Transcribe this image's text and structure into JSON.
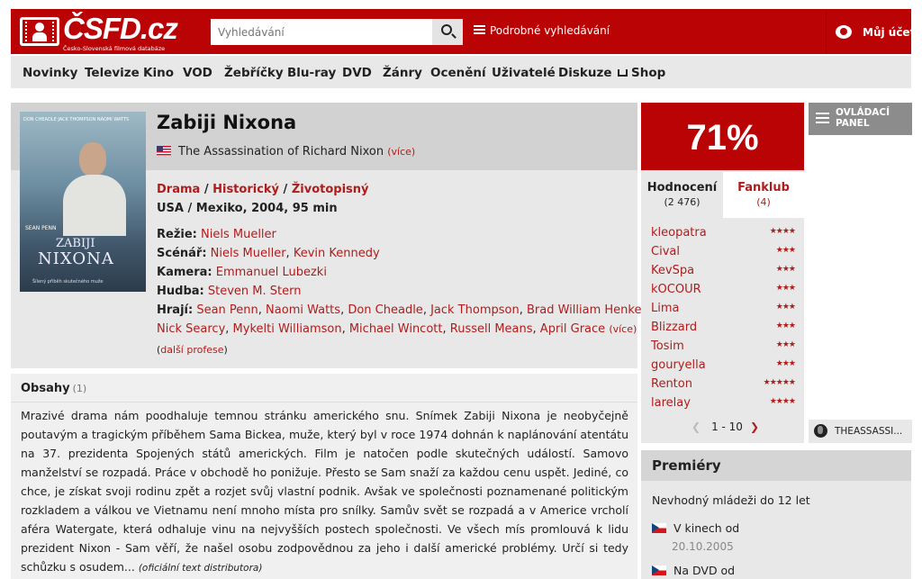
{
  "header": {
    "logo_text": "ČSFD.cz",
    "logo_tagline": "Česko-Slovenská filmová databáze",
    "search_placeholder": "Vyhledávání",
    "advanced_search": "Podrobné vyhledávání",
    "account": "Můj účet",
    "colors": {
      "brand": "#ba0305"
    }
  },
  "nav": [
    {
      "label": "Novinky"
    },
    {
      "label": "Televize"
    },
    {
      "label": "Kino"
    },
    {
      "label": "VOD"
    },
    {
      "label": "Žebříčky"
    },
    {
      "label": "Blu-ray"
    },
    {
      "label": "DVD"
    },
    {
      "label": "Žánry"
    },
    {
      "label": "Ocenění"
    },
    {
      "label": "Uživatelé"
    },
    {
      "label": "Diskuze"
    },
    {
      "label": "Shop",
      "icon": "cart-icon"
    }
  ],
  "film": {
    "title": "Zabiji Nixona",
    "original_title": "The Assassination of Richard Nixon",
    "original_flag": "us-flag-icon",
    "more": "(více)",
    "genres": [
      "Drama",
      "Historický",
      "Životopisný"
    ],
    "origin": "USA / Mexiko, 2004, 95 min",
    "poster": {
      "top_credits": "DON CHEADLE   JACK THOMPSON   NAOMI WATTS",
      "star": "SEAN PENN",
      "title_line1": "ZABIJI",
      "title_line2": "NIXONA",
      "tagline": "Šílený příběh skutečného muže"
    },
    "director_label": "Režie:",
    "director": "Niels Mueller",
    "screenplay_label": "Scénář:",
    "screenplay": [
      "Niels Mueller",
      "Kevin Kennedy"
    ],
    "camera_label": "Kamera:",
    "camera": "Emmanuel Lubezki",
    "music_label": "Hudba:",
    "music": "Steven M. Stern",
    "cast_label": "Hrají:",
    "cast_line1": [
      "Sean Penn",
      "Naomi Watts",
      "Don Cheadle",
      "Jack Thompson",
      "Brad William Henke"
    ],
    "cast_line2": [
      "Nick Searcy",
      "Mykelti Williamson",
      "Michael Wincott",
      "Russell Means",
      "April Grace"
    ],
    "cast_more": "(více)",
    "more_professions": "další profese"
  },
  "plot": {
    "heading": "Obsahy",
    "count": "(1)",
    "text": "Mrazivé drama nám poodhaluje temnou stránku amerického snu. Snímek Zabiji Nixona je neobyčejně poutavým a tragickým příběhem Sama Bickea, muže, který byl v roce 1974 dohnán k naplánování atentátu na 37. prezidenta Spojených států amerických. Film je natočen podle skutečných událostí. Samovo manželství se rozpadá. Práce v obchodě ho ponižuje. Přesto se Sam snaží za každou cenu uspět. Jediné, co chce, je získat svoji rodinu zpět a rozjet svůj vlastní podnik. Avšak ve společnosti poznamenané politickým rozkladem a válkou ve Vietnamu není mnoho místa pro snílky. Samův svět se rozpadá a v Americe vrcholí aféra Watergate, která odhaluje vinu na nejvyšších postech společnosti. Ve všech mís promlouvá k lidu prezident Nixon - Sam věří, že našel osobu zodpovědnou za jeho i další americké problémy. Určí si tedy schůzku s osudem...",
    "source": "(oficiální text distributora)"
  },
  "rating": {
    "score": "71%",
    "tab_ratings": {
      "label": "Hodnocení",
      "count": "(2 476)"
    },
    "tab_fanclub": {
      "label": "Fanklub",
      "count": "(4)"
    },
    "users": [
      {
        "name": "kleopatra",
        "stars": 4
      },
      {
        "name": "Cival",
        "stars": 3
      },
      {
        "name": "KevSpa",
        "stars": 3
      },
      {
        "name": "kOCOUR",
        "stars": 3
      },
      {
        "name": "Lima",
        "stars": 3
      },
      {
        "name": "Blizzard",
        "stars": 3
      },
      {
        "name": "Tosim",
        "stars": 3
      },
      {
        "name": "gouryella",
        "stars": 3
      },
      {
        "name": "Renton",
        "stars": 5
      },
      {
        "name": "larelay",
        "stars": 4
      }
    ],
    "pager": "1 - 10"
  },
  "premieres": {
    "heading": "Premiéry",
    "age": "Nevhodný mládeži do 12 let",
    "items": [
      {
        "label": "V kinech od",
        "date": "20.10.2005",
        "flag": "cz-flag-icon"
      },
      {
        "label": "Na DVD od",
        "flag": "cz-flag-icon"
      }
    ]
  },
  "side": {
    "control_panel": "OVLÁDACÍ\nPANEL",
    "website": "THEASSASSI..."
  }
}
